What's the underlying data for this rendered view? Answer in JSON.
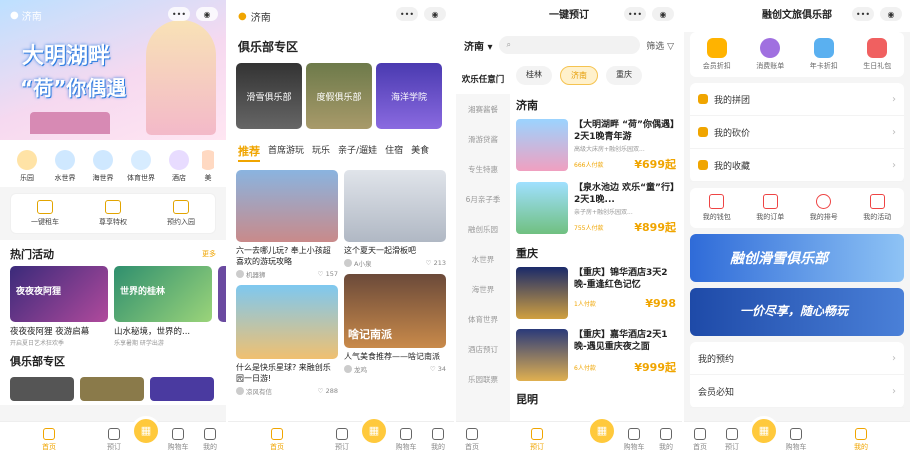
{
  "tabs": {
    "home": "首页",
    "book": "预订",
    "cart": "购物车",
    "me": "我的"
  },
  "p1": {
    "location": "济南",
    "banner_line1": "大明湖畔",
    "banner_line2": "“荷”你偶遇",
    "icons": [
      "乐园",
      "水世界",
      "海世界",
      "体育世界",
      "酒店",
      "美"
    ],
    "services": [
      "一键租车",
      "尊享特权",
      "预约入园"
    ],
    "hot_title": "热门活动",
    "more": "更多",
    "activities": [
      {
        "img_label": "夜夜夜阿狸",
        "title": "夜夜夜阿狸 夜游启幕",
        "sub": "开启夏日艺术狂欢季"
      },
      {
        "img_label": "世界的桂林",
        "title": "山水秘境，世界的...",
        "sub": "乐享暑期 研学出游"
      },
      {
        "img_label": "",
        "title": "",
        "sub": ""
      }
    ],
    "club_title": "俱乐部专区"
  },
  "p2": {
    "location": "济南",
    "club_title": "俱乐部专区",
    "clubs": [
      "滑雪俱乐部",
      "度假俱乐部",
      "海洋学院"
    ],
    "cats": [
      "推荐",
      "首席游玩",
      "玩乐",
      "亲子/遛娃",
      "住宿",
      "美食"
    ],
    "cards": [
      {
        "title": "六一去哪儿玩? 奉上小孩超喜欢的游玩攻略",
        "author": "机器狮",
        "likes": "157"
      },
      {
        "title": "这个夏天一起滑板吧",
        "author": "A小泉",
        "likes": "213"
      },
      {
        "title": "什么是快乐星球? 来融创乐园一日游!",
        "author": "凉风有信",
        "likes": "288"
      },
      {
        "title": "人气美食推荐——啥记南派",
        "author": "龙鸡",
        "likes": "34"
      }
    ],
    "card_overlay": "啥记南派"
  },
  "p3": {
    "title": "一键预订",
    "city": "济南",
    "search_placeholder": "",
    "filter": "筛选",
    "side": [
      "欢乐任意门",
      "湘赛酱餐",
      "滑游贷酱",
      "专生特惠",
      "6月亲子季",
      "融创乐园",
      "水世界",
      "海世界",
      "体育世界",
      "酒店预订",
      "乐园联票"
    ],
    "chips": [
      "桂林",
      "济南",
      "重庆"
    ],
    "sections": [
      {
        "city": "济南",
        "items": [
          {
            "title": "【大明湖畔 “荷”你偶遇】2天1晚青年游",
            "desc": "高级大床房+融创乐园双...",
            "sold": "666人付款",
            "price": "¥699起"
          },
          {
            "title": "【泉水池边 欢乐“童”行】2天1晚...",
            "desc": "亲子房+融创乐园双...",
            "sold": "755人付款",
            "price": "¥899起"
          }
        ]
      },
      {
        "city": "重庆",
        "items": [
          {
            "title": "【重庆】锦华酒店3天2晚-重逢红色记忆",
            "desc": "",
            "sold": "1人付款",
            "price": "¥998"
          },
          {
            "title": "【重庆】嘉华酒店2天1晚-遇见重庆夜之面",
            "desc": "",
            "sold": "6人付款",
            "price": "¥999起"
          }
        ]
      },
      {
        "city": "昆明",
        "items": []
      }
    ]
  },
  "p4": {
    "title": "融创文旅俱乐部",
    "rights": [
      "会员折扣",
      "消费账单",
      "年卡折扣",
      "生日礼包"
    ],
    "menu": [
      "我的拼团",
      "我的砍价",
      "我的收藏"
    ],
    "orders": [
      "我的钱包",
      "我的订单",
      "我的排号",
      "我的活动"
    ],
    "ski_banner": "融创滑雪俱乐部",
    "vac_banner": "一价尽享，随心畅玩",
    "bottom": [
      "我的预约",
      "会员必知"
    ]
  }
}
